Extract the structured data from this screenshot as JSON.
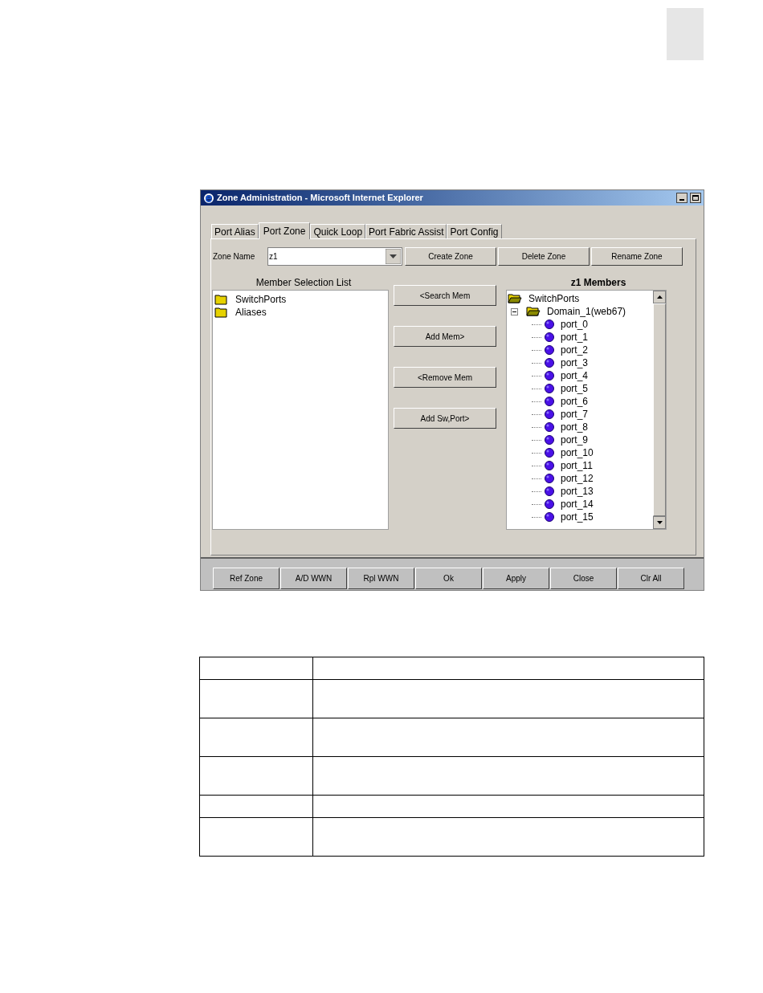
{
  "window": {
    "title": "Zone Administration - Microsoft Internet Explorer"
  },
  "tabs": [
    {
      "label": "Port Alias",
      "selected": false
    },
    {
      "label": "Port Zone",
      "selected": true
    },
    {
      "label": "Quick Loop",
      "selected": false
    },
    {
      "label": "Port Fabric Assist",
      "selected": false
    },
    {
      "label": "Port Config",
      "selected": false
    }
  ],
  "zone_name": {
    "label": "Zone Name",
    "value": "z1"
  },
  "zone_buttons": [
    "Create Zone",
    "Delete Zone",
    "Rename Zone"
  ],
  "member_selection_list": {
    "title": "Member Selection List",
    "items": [
      {
        "label": "SwitchPorts",
        "kind": "folder"
      },
      {
        "label": "Aliases",
        "kind": "folder"
      }
    ]
  },
  "member_buttons": [
    "<Search Mem",
    "Add Mem>",
    "<Remove Mem",
    "Add Sw,Port>"
  ],
  "members": {
    "title": "z1 Members",
    "tree": [
      {
        "label": "SwitchPorts",
        "kind": "folder",
        "expanded": true,
        "children": [
          {
            "label": "Domain_1(web67)",
            "kind": "folder",
            "expanded": true,
            "children": [
              {
                "label": "port_0",
                "kind": "port"
              },
              {
                "label": "port_1",
                "kind": "port"
              },
              {
                "label": "port_2",
                "kind": "port"
              },
              {
                "label": "port_3",
                "kind": "port"
              },
              {
                "label": "port_4",
                "kind": "port"
              },
              {
                "label": "port_5",
                "kind": "port"
              },
              {
                "label": "port_6",
                "kind": "port"
              },
              {
                "label": "port_7",
                "kind": "port"
              },
              {
                "label": "port_8",
                "kind": "port"
              },
              {
                "label": "port_9",
                "kind": "port"
              },
              {
                "label": "port_10",
                "kind": "port"
              },
              {
                "label": "port_11",
                "kind": "port"
              },
              {
                "label": "port_12",
                "kind": "port"
              },
              {
                "label": "port_13",
                "kind": "port"
              },
              {
                "label": "port_14",
                "kind": "port"
              },
              {
                "label": "port_15",
                "kind": "port"
              }
            ]
          }
        ]
      }
    ]
  },
  "bottom_buttons": [
    "Ref Zone",
    "A/D WWN",
    "Rpl WWN",
    "Ok",
    "Apply",
    "Close",
    "Clr All"
  ]
}
